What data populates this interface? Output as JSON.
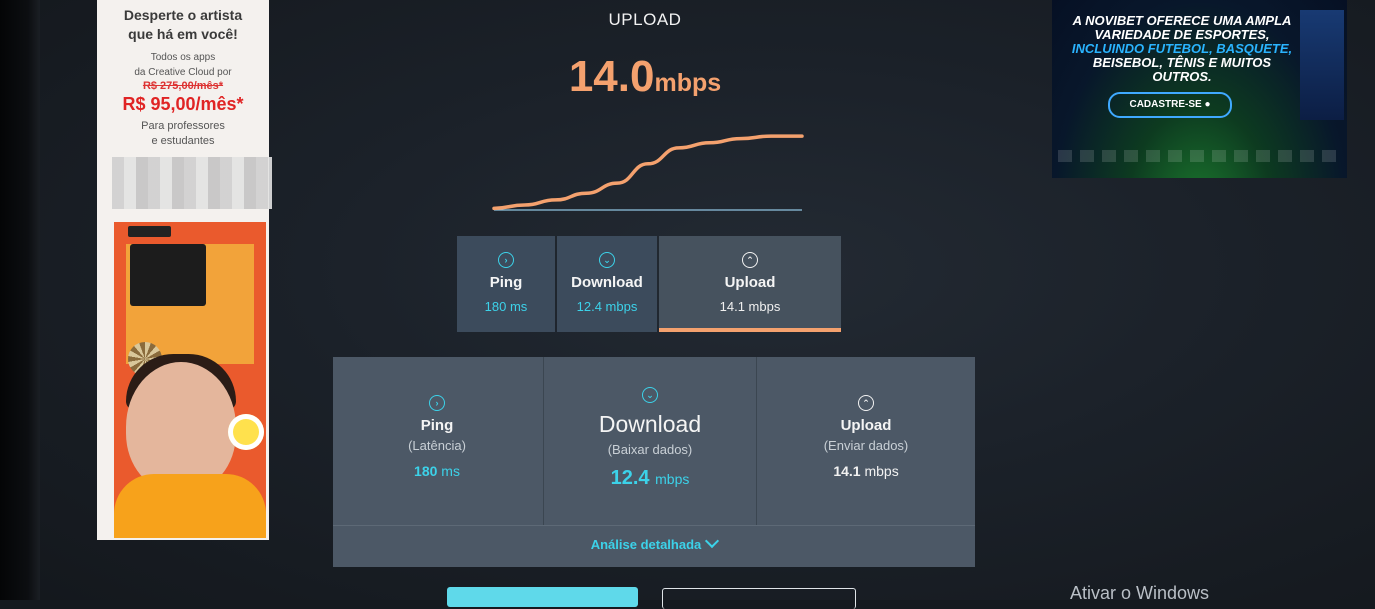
{
  "left_ad": {
    "headline": [
      "Desperte o artista",
      "que há em você!"
    ],
    "desc": [
      "Todos os apps",
      "da Creative Cloud por"
    ],
    "old_price": "R$ 275,00/mês*",
    "new_price": "R$ 95,00/mês*",
    "audience": [
      "Para professores",
      "e estudantes"
    ]
  },
  "right_ad": {
    "line1": "A NOVIBET OFERECE UMA AMPLA",
    "line2": "VARIEDADE DE ESPORTES,",
    "line3": "INCLUINDO FUTEBOL, BASQUETE,",
    "line4": "BEISEBOL, TÊNIS E MUITOS OUTROS.",
    "cta": "CADASTRE-SE ●"
  },
  "test": {
    "phase": "UPLOAD",
    "live_value": "14.0",
    "live_unit": "mbps",
    "graph_values": [
      0.02,
      0.06,
      0.12,
      0.2,
      0.32,
      0.55,
      0.74,
      0.8,
      0.85,
      0.88,
      0.88
    ]
  },
  "mini": {
    "ping_label": "Ping",
    "ping_value": "180 ms",
    "download_label": "Download",
    "download_value": "12.4 mbps",
    "upload_label": "Upload",
    "upload_value": "14.1 mbps"
  },
  "results": {
    "ping_label": "Ping",
    "ping_sub": "(Latência)",
    "ping_value": "180",
    "ping_unit": "ms",
    "download_label": "Download",
    "download_sub": "(Baixar dados)",
    "download_value": "12.4",
    "download_unit": "mbps",
    "upload_label": "Upload",
    "upload_sub": "(Enviar dados)",
    "upload_value": "14.1",
    "upload_unit": "mbps",
    "analise": "Análise detalhada"
  },
  "windows_watermark": "Ativar o Windows",
  "colors": {
    "accent_orange": "#f4a16e",
    "accent_cyan": "#3cd2e9"
  }
}
